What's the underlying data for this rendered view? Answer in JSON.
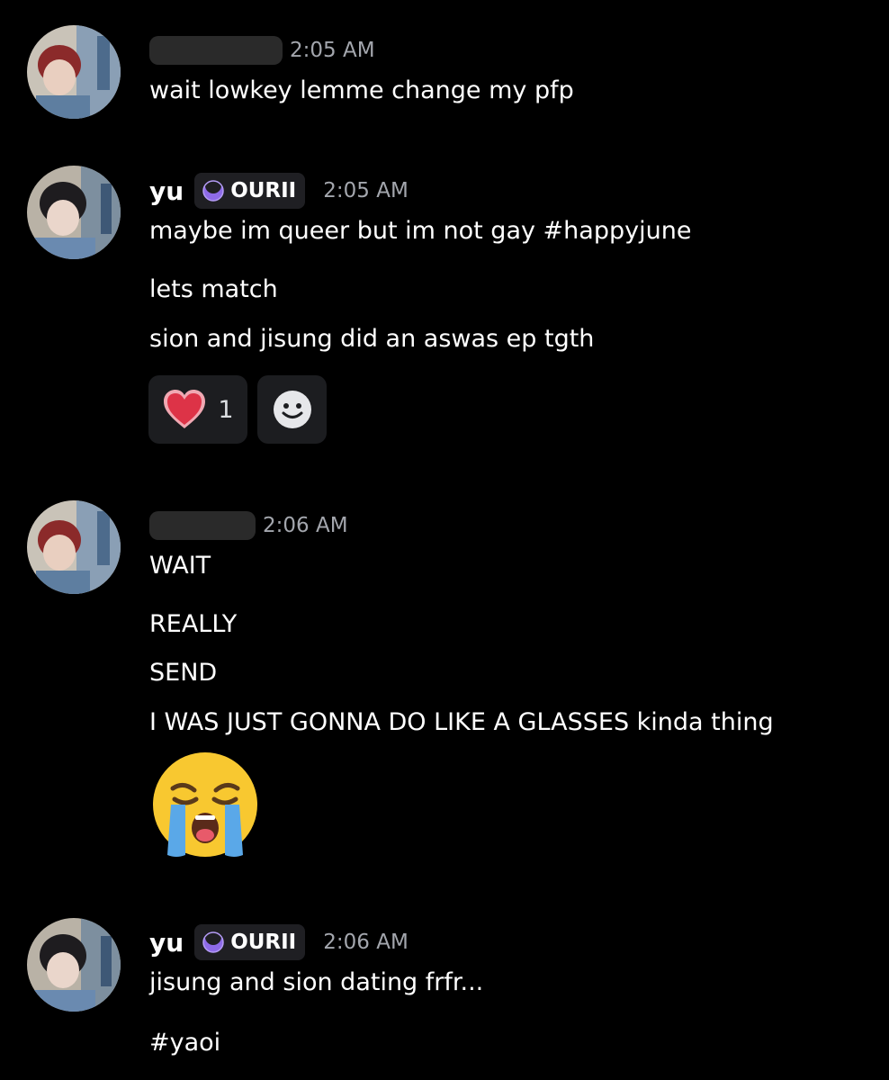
{
  "messages": [
    {
      "author": "",
      "timestamp": "2:05 AM",
      "lines": [
        "wait lowkey lemme change my pfp"
      ]
    },
    {
      "author": "yu",
      "role": "OURII",
      "timestamp": "2:05 AM",
      "lines": [
        "maybe im queer but im not gay #happyjune",
        "lets match",
        "sion and jisung did an aswas ep tgth"
      ],
      "reactions": [
        {
          "emoji": "heart-emoji",
          "count": "1"
        },
        {
          "emoji": "add-reaction-icon",
          "count": ""
        }
      ]
    },
    {
      "author": "",
      "timestamp": "2:06 AM",
      "lines": [
        "WAIT",
        "REALLY",
        "SEND",
        "I WAS JUST GONNA DO LIKE A GLASSES kinda thing"
      ],
      "emoji": "loudly-crying-face-emoji"
    },
    {
      "author": "yu",
      "role": "OURII",
      "timestamp": "2:06 AM",
      "lines": [
        "jisung and sion dating frfr...",
        "#yaoi"
      ]
    }
  ],
  "colors": {
    "background": "#000000",
    "text": "#ffffff",
    "timestamp": "#a3a6ad",
    "role_accent": "#8e6be8",
    "reaction_bg": "#1c1d20"
  }
}
